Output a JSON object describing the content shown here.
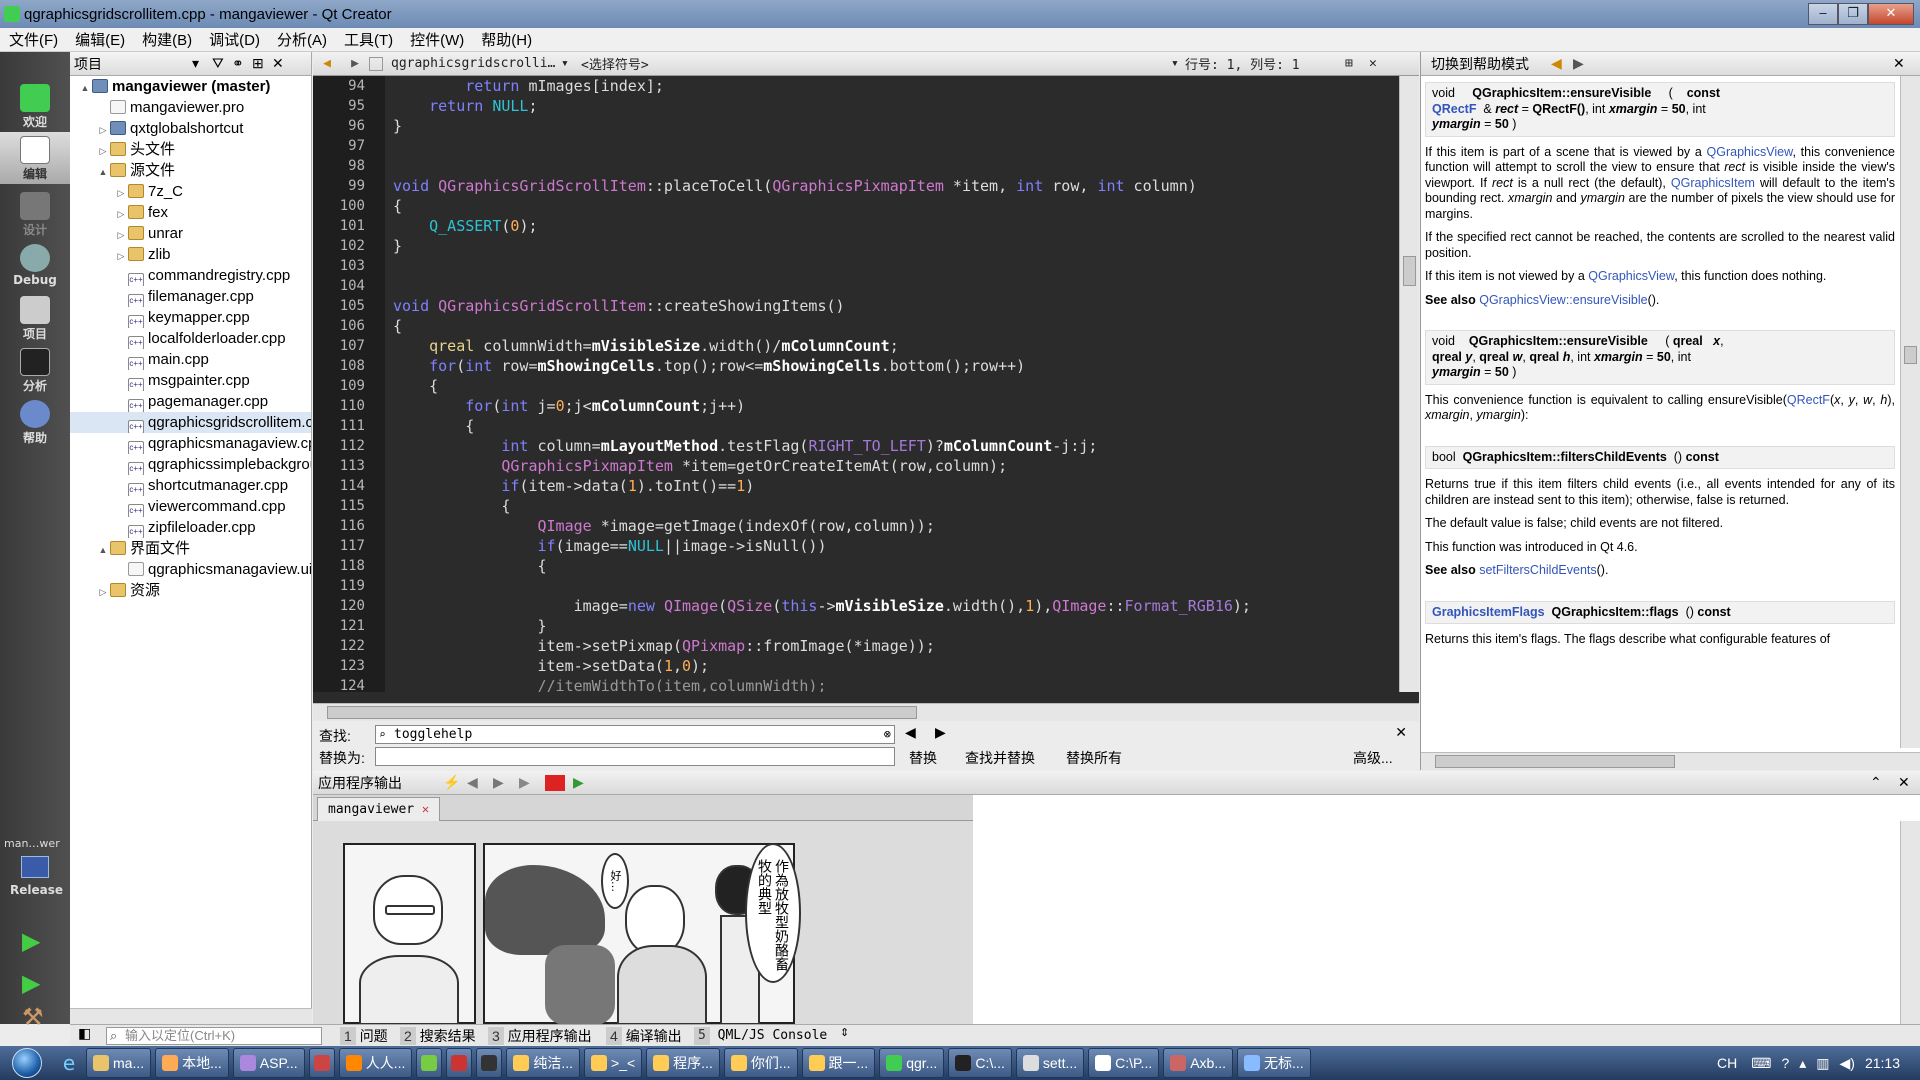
{
  "window": {
    "title": "qgraphicsgridscrollitem.cpp - mangaviewer - Qt Creator"
  },
  "menu": [
    "文件(F)",
    "编辑(E)",
    "构建(B)",
    "调试(D)",
    "分析(A)",
    "工具(T)",
    "控件(W)",
    "帮助(H)"
  ],
  "modes": [
    {
      "label": "欢迎"
    },
    {
      "label": "编辑"
    },
    {
      "label": "设计"
    },
    {
      "label": "Debug"
    },
    {
      "label": "项目"
    },
    {
      "label": "分析"
    },
    {
      "label": "帮助"
    }
  ],
  "kit": {
    "project": "man…wer",
    "config": "Release"
  },
  "projects": {
    "header": "项目",
    "tree": [
      {
        "label": "mangaviewer (master)",
        "level": 0,
        "type": "proj",
        "arrow": "▲",
        "bold": true
      },
      {
        "label": "mangaviewer.pro",
        "level": 1,
        "type": "file"
      },
      {
        "label": "qxtglobalshortcut",
        "level": 1,
        "type": "proj",
        "arrow": "▷"
      },
      {
        "label": "头文件",
        "level": 1,
        "type": "folder",
        "arrow": "▷"
      },
      {
        "label": "源文件",
        "level": 1,
        "type": "folder",
        "arrow": "▲"
      },
      {
        "label": "7z_C",
        "level": 2,
        "type": "folder",
        "arrow": "▷"
      },
      {
        "label": "fex",
        "level": 2,
        "type": "folder",
        "arrow": "▷"
      },
      {
        "label": "unrar",
        "level": 2,
        "type": "folder",
        "arrow": "▷"
      },
      {
        "label": "zlib",
        "level": 2,
        "type": "folder",
        "arrow": "▷"
      },
      {
        "label": "commandregistry.cpp",
        "level": 2,
        "type": "cpp"
      },
      {
        "label": "filemanager.cpp",
        "level": 2,
        "type": "cpp"
      },
      {
        "label": "keymapper.cpp",
        "level": 2,
        "type": "cpp"
      },
      {
        "label": "localfolderloader.cpp",
        "level": 2,
        "type": "cpp"
      },
      {
        "label": "main.cpp",
        "level": 2,
        "type": "cpp"
      },
      {
        "label": "msgpainter.cpp",
        "level": 2,
        "type": "cpp"
      },
      {
        "label": "pagemanager.cpp",
        "level": 2,
        "type": "cpp"
      },
      {
        "label": "qgraphicsgridscrollitem.cpp",
        "level": 2,
        "type": "cpp",
        "selected": true
      },
      {
        "label": "qgraphicsmanagaview.cpp",
        "level": 2,
        "type": "cpp"
      },
      {
        "label": "qgraphicssimplebackground.cpp",
        "level": 2,
        "type": "cpp"
      },
      {
        "label": "shortcutmanager.cpp",
        "level": 2,
        "type": "cpp"
      },
      {
        "label": "viewercommand.cpp",
        "level": 2,
        "type": "cpp"
      },
      {
        "label": "zipfileloader.cpp",
        "level": 2,
        "type": "cpp"
      },
      {
        "label": "界面文件",
        "level": 1,
        "type": "folder",
        "arrow": "▲"
      },
      {
        "label": "qgraphicsmanagaview.ui",
        "level": 2,
        "type": "file"
      },
      {
        "label": "资源",
        "level": 1,
        "type": "folder",
        "arrow": "▷"
      }
    ]
  },
  "editor": {
    "file": "qgraphicsgridscrolli…",
    "symbol": "<选择符号>",
    "position": "行号: 1, 列号: 1",
    "lines": [
      {
        "n": "94",
        "html": "        <span class='kw'>return</span> mImages[index];"
      },
      {
        "n": "95",
        "html": "    <span class='kw'>return</span> <span class='nul'>NULL</span>;"
      },
      {
        "n": "96",
        "html": "}"
      },
      {
        "n": "97",
        "html": ""
      },
      {
        "n": "98",
        "html": ""
      },
      {
        "n": "99",
        "html": "<span class='kw'>void</span> <span class='ty'>QGraphicsGridScrollItem</span>::placeToCell(<span class='ty'>QGraphicsPixmapItem</span> *item, <span class='kw'>int</span> row, <span class='kw'>int</span> column)"
      },
      {
        "n": "100",
        "html": "{"
      },
      {
        "n": "101",
        "html": "    <span class='nul'>Q_ASSERT</span>(<span class='nm'>0</span>);"
      },
      {
        "n": "102",
        "html": "}"
      },
      {
        "n": "103",
        "html": ""
      },
      {
        "n": "104",
        "html": ""
      },
      {
        "n": "105",
        "html": "<span class='kw'>void</span> <span class='ty'>QGraphicsGridScrollItem</span>::createShowingItems()"
      },
      {
        "n": "106",
        "html": "{"
      },
      {
        "n": "107",
        "html": "    <span class='fn'>qreal</span> columnWidth=<span class='mb'>mVisibleSize</span>.width()/<span class='mb'>mColumnCount</span>;"
      },
      {
        "n": "108",
        "html": "    <span class='kw'>for</span>(<span class='kw'>int</span> row=<span class='mb'>mShowingCells</span>.top();row&lt;=<span class='mb'>mShowingCells</span>.bottom();row++)"
      },
      {
        "n": "109",
        "html": "    {"
      },
      {
        "n": "110",
        "html": "        <span class='kw'>for</span>(<span class='kw'>int</span> j=<span class='nm'>0</span>;j&lt;<span class='mb'>mColumnCount</span>;j++)"
      },
      {
        "n": "111",
        "html": "        {"
      },
      {
        "n": "112",
        "html": "            <span class='kw'>int</span> column=<span class='mb'>mLayoutMethod</span>.testFlag(<span class='mc'>RIGHT_TO_LEFT</span>)?<span class='mb'>mColumnCount</span>-j:j;"
      },
      {
        "n": "113",
        "html": "            <span class='ty'>QGraphicsPixmapItem</span> *item=getOrCreateItemAt(row,column);"
      },
      {
        "n": "114",
        "html": "            <span class='kw'>if</span>(item-&gt;data(<span class='nm'>1</span>).toInt()==<span class='nm'>1</span>)"
      },
      {
        "n": "115",
        "html": "            {"
      },
      {
        "n": "116",
        "html": "                <span class='ty'>QImage</span> *image=getImage(indexOf(row,column));"
      },
      {
        "n": "117",
        "html": "                <span class='kw'>if</span>(image==<span class='nul'>NULL</span>||image-&gt;isNull())"
      },
      {
        "n": "118",
        "html": "                {"
      },
      {
        "n": "119",
        "html": ""
      },
      {
        "n": "120",
        "html": "                    image=<span class='kw'>new</span> <span class='ty'>QImage</span>(<span class='ty'>QSize</span>(<span class='kw'>this</span>-&gt;<span class='mb'>mVisibleSize</span>.width(),<span class='nm'>1</span>),<span class='ty'>QImage</span>::<span class='mc'>Format_RGB16</span>);"
      },
      {
        "n": "121",
        "html": "                }"
      },
      {
        "n": "122",
        "html": "                item-&gt;setPixmap(<span class='ty'>QPixmap</span>::fromImage(*image));"
      },
      {
        "n": "123",
        "html": "                item-&gt;setData(<span class='nm'>1</span>,<span class='nm'>0</span>);"
      },
      {
        "n": "124",
        "html": "                <span class='cm'>//itemWidthTo(item,columnWidth);</span>"
      }
    ]
  },
  "find": {
    "find_label": "查找:",
    "replace_label": "替换为:",
    "query": "togglehelp",
    "replace_btn": "替换",
    "find_replace_btn": "查找并替换",
    "replace_all_btn": "替换所有",
    "advanced": "高级..."
  },
  "help": {
    "header": "切换到帮助模式",
    "blocks": [
      {
        "kind": "sig",
        "html": "void &nbsp;&nbsp;&nbsp;&nbsp;<b>QGraphicsItem::ensureVisible</b> &nbsp;&nbsp;&nbsp;&nbsp;( &nbsp;&nbsp;&nbsp;<b>const</b><br><span class='lnk'><b>QRectF</b></span> &nbsp;&amp; <b><i>rect</i></b> = <b>QRectF()</b>, int <b><i>xmargin</i></b> = <b>50</b>, int<br><b><i>ymargin</i></b> = <b>50</b> )"
      },
      {
        "kind": "p",
        "html": "If this item is part of a scene that is viewed by a <span class='lnk'>QGraphicsView</span>, this convenience function will attempt to scroll the view to ensure that <i>rect</i> is visible inside the view's viewport. If <i>rect</i> is a null rect (the default), <span class='lnk'>QGraphicsItem</span> will default to the item's bounding rect. <i>xmargin</i> and <i>ymargin</i> are the number of pixels the view should use for margins."
      },
      {
        "kind": "p",
        "html": "If the specified rect cannot be reached, the contents are scrolled to the nearest valid position."
      },
      {
        "kind": "p",
        "html": "If this item is not viewed by a <span class='lnk'>QGraphicsView</span>, this function does nothing."
      },
      {
        "kind": "p",
        "html": "<b>See also</b> <span class='lnk'>QGraphicsView::ensureVisible</span>()."
      },
      {
        "kind": "sig",
        "html": "void &nbsp;&nbsp;&nbsp;<b>QGraphicsItem::ensureVisible</b> &nbsp;&nbsp;&nbsp;&nbsp;( <b>qreal</b> &nbsp;&nbsp;<b><i>x</i></b>,<br><b>qreal</b> <b><i>y</i></b>, <b>qreal</b> <b><i>w</i></b>, <b>qreal</b> <b><i>h</i></b>, int <b><i>xmargin</i></b> = <b>50</b>, int<br><b><i>ymargin</i></b> = <b>50</b> )"
      },
      {
        "kind": "p",
        "html": "This convenience function is equivalent to calling ensureVisible(<span class='lnk'>QRectF</span>(<i>x</i>, <i>y</i>, <i>w</i>, <i>h</i>), <i>xmargin</i>, <i>ymargin</i>):"
      },
      {
        "kind": "sig",
        "html": "bool &nbsp;<b>QGraphicsItem::filtersChildEvents</b> &nbsp;() <b>const</b>"
      },
      {
        "kind": "p",
        "html": "Returns true if this item filters child events (i.e., all events intended for any of its children are instead sent to this item); otherwise, false is returned."
      },
      {
        "kind": "p",
        "html": "The default value is false; child events are not filtered."
      },
      {
        "kind": "p",
        "html": "This function was introduced in Qt 4.6."
      },
      {
        "kind": "p",
        "html": "<b>See also</b> <span class='lnk'>setFiltersChildEvents</span>()."
      },
      {
        "kind": "sig",
        "html": "<span class='lnk'><b>GraphicsItemFlags</b></span> &nbsp;<b>QGraphicsItem::flags</b> &nbsp;() <b>const</b>"
      },
      {
        "kind": "p",
        "html": "Returns this item's flags. The flags describe what configurable features of"
      }
    ]
  },
  "output": {
    "header": "应用程序输出",
    "tab": "mangaviewer",
    "manga_text_1": "作為放牧型奶酪",
    "manga_text_2": "畜牧的典型",
    "manga_text_3": "好…"
  },
  "status": {
    "locator_placeholder": "输入以定位(Ctrl+K)",
    "tabs": [
      {
        "n": "1",
        "label": "问题"
      },
      {
        "n": "2",
        "label": "搜索结果"
      },
      {
        "n": "3",
        "label": "应用程序输出"
      },
      {
        "n": "4",
        "label": "编译输出"
      },
      {
        "n": "5",
        "label": "QML/JS Console"
      }
    ]
  },
  "taskbar": {
    "items": [
      "ma...",
      "本地...",
      "ASP...",
      "",
      "人人...",
      "",
      "",
      "",
      "纯洁...",
      ">_<",
      "程序...",
      "你们...",
      "跟一...",
      "qgr...",
      "C:\\...",
      "sett...",
      "C:\\P...",
      "Axb...",
      "无标..."
    ],
    "ime": "CH",
    "clock": "21:13"
  }
}
